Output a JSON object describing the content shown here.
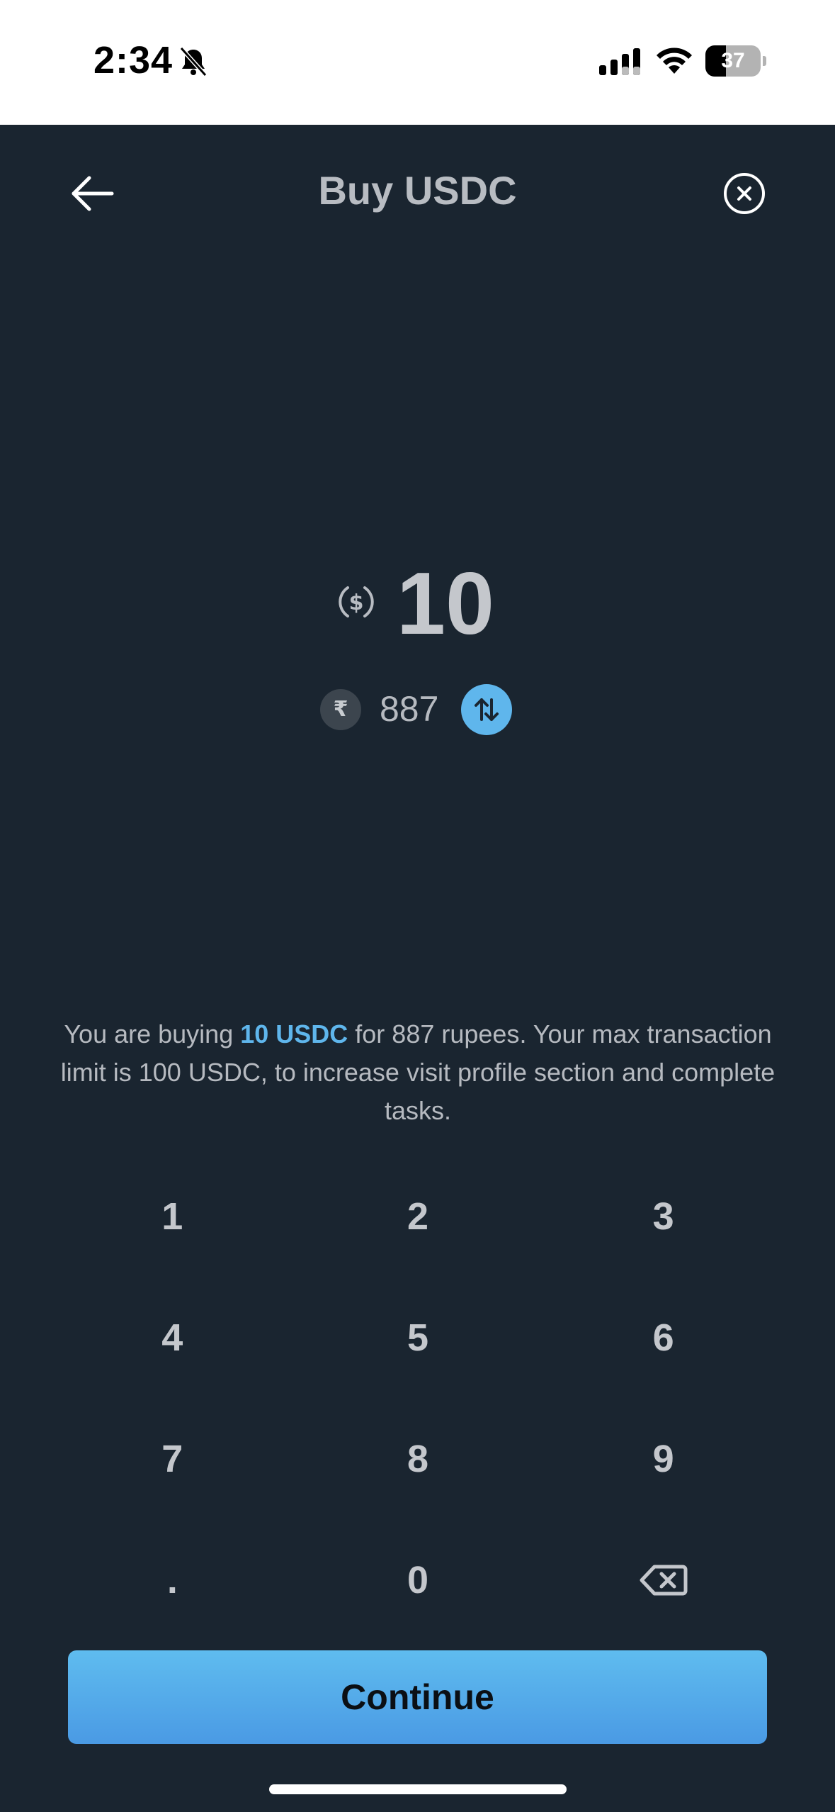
{
  "status_bar": {
    "time": "2:34",
    "battery": "37",
    "battery_level_percent": 37
  },
  "header": {
    "title": "Buy USDC",
    "back_icon": "arrow-left-icon",
    "close_icon": "close-circle-icon"
  },
  "amount": {
    "crypto_icon": "usd-coin-icon",
    "crypto_value": "10",
    "fiat_symbol": "₹",
    "fiat_value": "887",
    "swap_icon": "swap-vertical-icon"
  },
  "info": {
    "prefix": "You are buying ",
    "highlight": "10 USDC",
    "suffix": " for 887 rupees. Your max transaction limit is 100 USDC, to increase visit profile section and complete tasks."
  },
  "keypad": {
    "keys": [
      "1",
      "2",
      "3",
      "4",
      "5",
      "6",
      "7",
      "8",
      "9",
      ".",
      "0"
    ],
    "backspace_icon": "backspace-icon"
  },
  "continue_label": "Continue",
  "colors": {
    "background": "#1a2530",
    "accent": "#5fb6ec",
    "text": "#c4c7cc"
  }
}
